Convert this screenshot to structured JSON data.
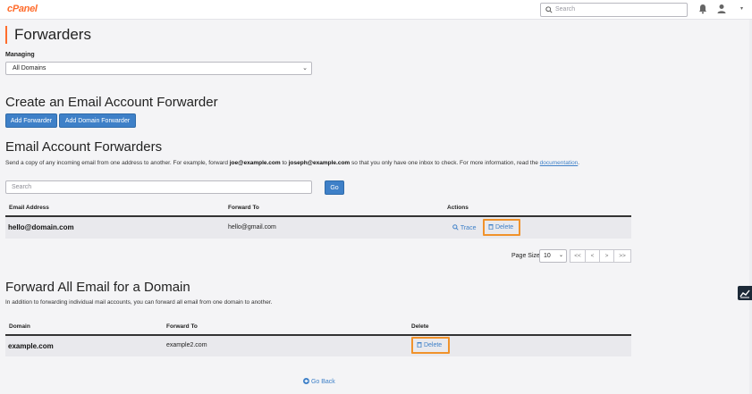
{
  "brand": {
    "logo_text": "cPanel",
    "accent_color": "#ff6c2c",
    "link_color": "#3e80c8"
  },
  "topbar": {
    "search_placeholder": "Search",
    "icons": [
      "search-icon",
      "bell-icon",
      "user-icon",
      "chevron-down-icon"
    ]
  },
  "page": {
    "title": "Forwarders"
  },
  "managing": {
    "label": "Managing",
    "selected": "All Domains"
  },
  "create": {
    "heading": "Create an Email Account Forwarder",
    "add_forwarder": "Add Forwarder",
    "add_domain_forwarder": "Add Domain Forwarder"
  },
  "email_forwarders": {
    "heading": "Email Account Forwarders",
    "desc_pre": "Send a copy of any incoming email from one address to another. For example, forward ",
    "desc_ex1": "joe@example.com",
    "desc_mid": " to ",
    "desc_ex2": "joseph@example.com",
    "desc_post": " so that you only have one inbox to check. For more information, read the ",
    "desc_link": "documentation",
    "desc_end": ".",
    "search_placeholder": "Search",
    "go_label": "Go",
    "columns": [
      "Email Address",
      "Forward To",
      "Actions"
    ],
    "rows": [
      {
        "email": "hello@domain.com",
        "forward_to": "hello@gmail.com",
        "trace": "Trace",
        "delete": "Delete"
      }
    ],
    "page_size_label": "Page Size",
    "page_size": "10",
    "pager": [
      "<<",
      "<",
      ">",
      ">>"
    ]
  },
  "domain_forwarders": {
    "heading": "Forward All Email for a Domain",
    "desc": "In addition to forwarding individual mail accounts, you can forward all email from one domain to another.",
    "columns": [
      "Domain",
      "Forward To",
      "Delete"
    ],
    "rows": [
      {
        "domain": "example.com",
        "forward_to": "example2.com",
        "delete": "Delete"
      }
    ]
  },
  "footer": {
    "go_back": "Go Back"
  }
}
